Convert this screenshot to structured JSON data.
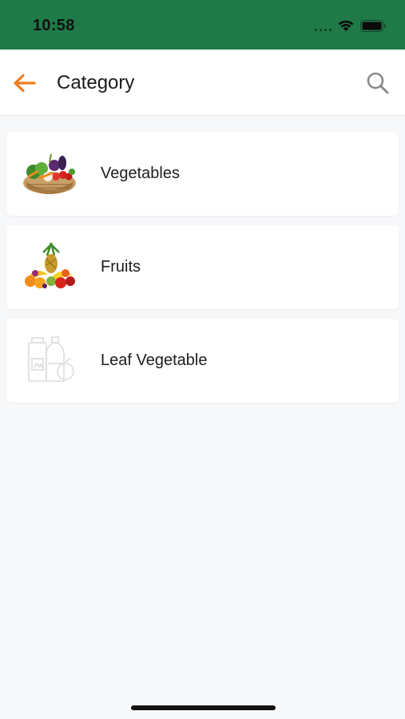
{
  "status_bar": {
    "time": "10:58",
    "icons": [
      "signal-dots-icon",
      "wifi-icon",
      "battery-icon"
    ]
  },
  "app_bar": {
    "title": "Category",
    "back_icon": "arrow-left-icon",
    "search_icon": "search-icon"
  },
  "categories": [
    {
      "label": "Vegetables",
      "image": "vegetable-basket-image"
    },
    {
      "label": "Fruits",
      "image": "fruit-assortment-image"
    },
    {
      "label": "Leaf Vegetable",
      "image": "placeholder-grocery-icon"
    }
  ],
  "colors": {
    "status_bar": "#1f7a48",
    "accent": "#f07b1d",
    "background": "#f7f8fa",
    "card": "#ffffff"
  }
}
